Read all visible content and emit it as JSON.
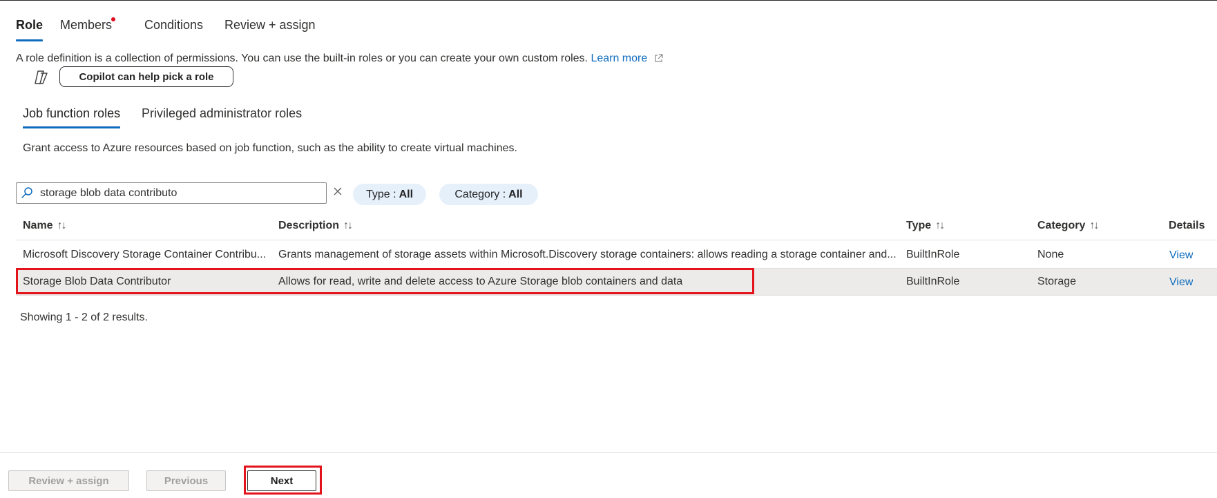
{
  "main_tabs": [
    {
      "label": "Role",
      "active": true
    },
    {
      "label": "Members",
      "active": false,
      "has_dot": true
    },
    {
      "label": "Conditions",
      "active": false
    },
    {
      "label": "Review + assign",
      "active": false
    }
  ],
  "intro": {
    "text": "A role definition is a collection of permissions. You can use the built-in roles or you can create your own custom roles. ",
    "learn_more": "Learn more"
  },
  "copilot_button": "Copilot can help pick a role",
  "sub_tabs": [
    {
      "label": "Job function roles",
      "active": true
    },
    {
      "label": "Privileged administrator roles",
      "active": false
    }
  ],
  "grant_text": "Grant access to Azure resources based on job function, such as the ability to create virtual machines.",
  "search": {
    "value": "storage blob data contributo"
  },
  "filters": {
    "type": {
      "label": "Type : ",
      "value": "All"
    },
    "category": {
      "label": "Category : ",
      "value": "All"
    }
  },
  "table": {
    "headers": {
      "name": "Name",
      "description": "Description",
      "type": "Type",
      "category": "Category",
      "details": "Details"
    },
    "sort_glyph": "↑↓",
    "rows": [
      {
        "name": "Microsoft Discovery Storage Container Contribu...",
        "description": "Grants management of storage assets within Microsoft.Discovery storage containers: allows reading a storage container and...",
        "type": "BuiltInRole",
        "category": "None",
        "details": "View",
        "selected": false
      },
      {
        "name": "Storage Blob Data Contributor",
        "description": "Allows for read, write and delete access to Azure Storage blob containers and data",
        "type": "BuiltInRole",
        "category": "Storage",
        "details": "View",
        "selected": true
      }
    ]
  },
  "results_text": "Showing 1 - 2 of 2 results.",
  "footer": {
    "review_assign": "Review + assign",
    "previous": "Previous",
    "next": "Next"
  },
  "colors": {
    "accent": "#0f6cbd",
    "highlight": "#e3131c",
    "selected_row": "#edebe9",
    "pill_bg": "#e6f0fb"
  }
}
